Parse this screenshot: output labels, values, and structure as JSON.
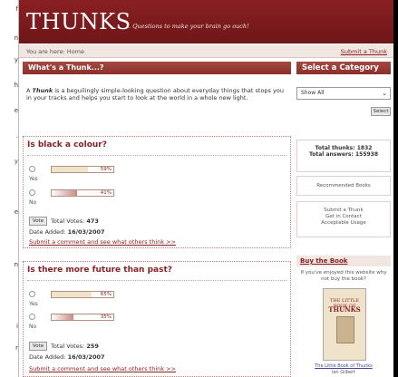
{
  "left_fragments": [
    "f",
    "n",
    "y",
    "h",
    "e",
    ".",
    "y",
    "e",
    "n",
    "i",
    "r"
  ],
  "header": {
    "logo": "THUNKS",
    "tagline": "... Questions to make your brain go ouch!"
  },
  "breadcrumb": {
    "prefix": "You are here:",
    "home": "Home",
    "submit": "Submit a Thunk"
  },
  "intro": {
    "title": "What's a Thunk...?",
    "text_bold": "Thunk",
    "text_before": "A ",
    "text_after": " is a beguilingly simple-looking question about everyday things that stops you in your tracks and helps you start to look at the world in a whole new light."
  },
  "polls": [
    {
      "question": "Is black a colour?",
      "options": [
        {
          "label": "Yes",
          "percent": 59,
          "percent_label": "59%"
        },
        {
          "label": "No",
          "percent": 41,
          "percent_label": "41%"
        }
      ],
      "vote_label": "Vote",
      "total_prefix": "Total Votes:",
      "total": "473",
      "date_prefix": "Date Added:",
      "date": "16/03/2007",
      "comment_link": "Submit a comment and see what others think >>"
    },
    {
      "question": "Is there more future than past?",
      "options": [
        {
          "label": "Yes",
          "percent": 65,
          "percent_label": "65%"
        },
        {
          "label": "No",
          "percent": 35,
          "percent_label": "35%"
        }
      ],
      "vote_label": "Vote",
      "total_prefix": "Total Votes:",
      "total": "259",
      "date_prefix": "Date Added:",
      "date": "16/03/2007",
      "comment_link": "Submit a comment and see what others think >>"
    }
  ],
  "sidebar": {
    "category_title": "Select a Category",
    "category_selected": "Show All",
    "select_button": "Select",
    "total_thunks": "Total thunks: 1832",
    "total_answers": "Total answers: 155938",
    "recommended": "Recommended Books",
    "links": [
      "Submit a Thunk",
      "Get in Contact",
      "Acceptable Usage"
    ],
    "buy_title": "Buy the Book",
    "buy_text": "If you've enjoyed this website why not buy the book?",
    "book_cover_top": "THE LITTLE BOOK OF",
    "book_cover_title": "THUNKS",
    "book_link": "The Little Book of Thunks",
    "book_author": "Ian Gilbert"
  },
  "colors": {
    "brand": "#8a2023",
    "bar_fill_yes": "#efe3cc",
    "bar_fill_no": "#c98a86"
  }
}
